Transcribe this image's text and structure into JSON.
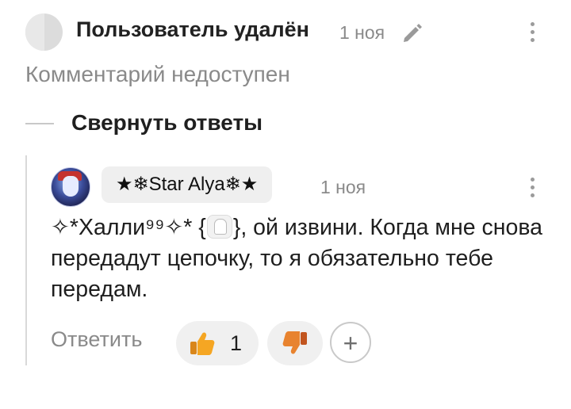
{
  "parent_comment": {
    "author": "Пользователь удалён",
    "time": "1 ноя",
    "body": "Комментарий недоступен"
  },
  "thread": {
    "collapse_label": "Свернуть ответы"
  },
  "reply": {
    "author": "★❄Star Alya❄★",
    "time": "1 ноя",
    "text": "✧*Халли⁹⁹✧* {",
    "text_after_emoji": "}, ой извини. Когда мне снова передадут цепочку, то я обязательно тебе передам.",
    "reply_label": "Ответить",
    "likes": "1",
    "add_reaction": "+"
  },
  "colors": {
    "thumb_up": "#f5a623",
    "thumb_down": "#e06a2c",
    "muted_text": "#8a8a8a"
  },
  "icons": {
    "edit": "pencil-icon",
    "menu": "kebab-menu-icon",
    "like": "thumbs-up-icon",
    "dislike": "thumbs-down-icon",
    "ghost": "ghost-emoji-icon"
  }
}
